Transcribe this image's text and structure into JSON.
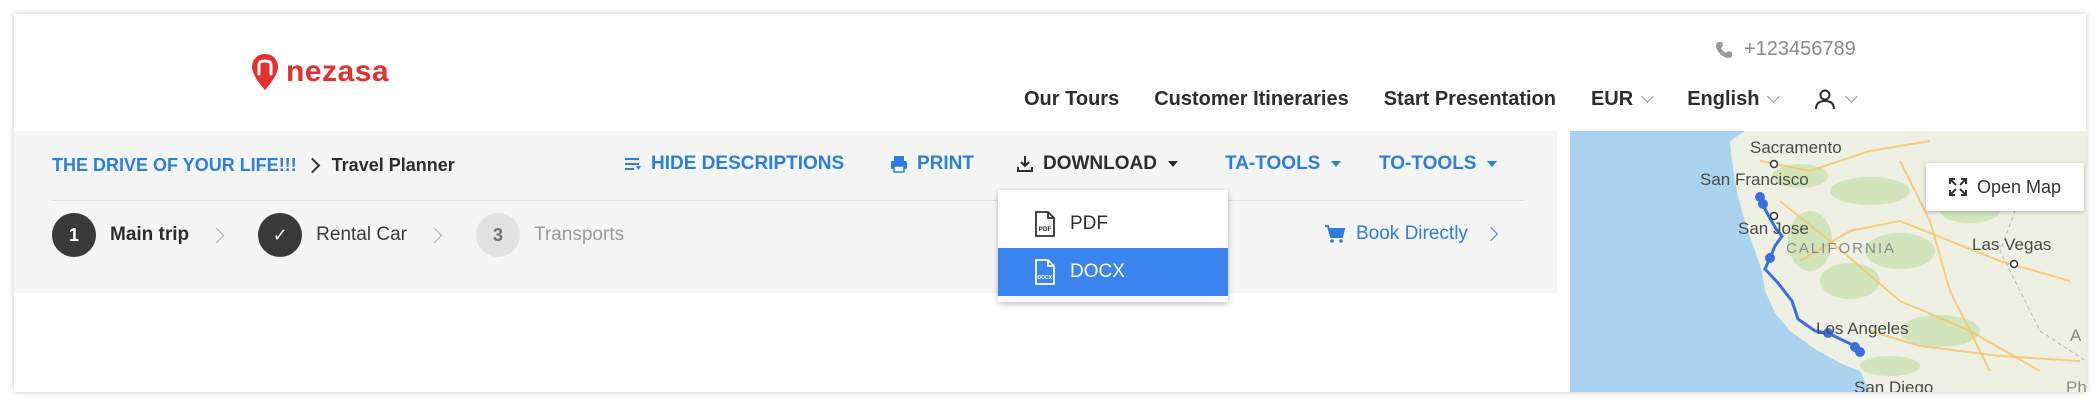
{
  "brand": {
    "name": "nezasa",
    "color": "#e63030"
  },
  "header": {
    "phone": "+123456789",
    "phone_icon": "phone-icon",
    "nav": {
      "our_tours": "Our Tours",
      "customer_itineraries": "Customer Itineraries",
      "start_presentation": "Start Presentation",
      "currency": "EUR",
      "language": "English",
      "user_icon": "user-icon"
    }
  },
  "breadcrumb": {
    "trip": "THE DRIVE OF YOUR LIFE!!!",
    "current": "Travel Planner"
  },
  "toolbar": {
    "hide_descriptions": "HIDE DESCRIPTIONS",
    "print": "PRINT",
    "download": "DOWNLOAD",
    "ta_tools": "TA-TOOLS",
    "to_tools": "TO-TOOLS"
  },
  "steps": [
    {
      "number": "1",
      "label": "Main trip",
      "state": "current"
    },
    {
      "number": "✓",
      "label": "Rental Car",
      "state": "done"
    },
    {
      "number": "3",
      "label": "Transports",
      "state": "pending"
    }
  ],
  "book_directly": "Book Directly",
  "download_menu": {
    "items": [
      {
        "label": "PDF",
        "icon_text": "PDF",
        "selected": false
      },
      {
        "label": "DOCX",
        "icon_text": "DOCX",
        "selected": true
      }
    ]
  },
  "map": {
    "open_map": "Open Map",
    "labels": {
      "sacramento": "Sacramento",
      "san_francisco": "San Francisco",
      "san_jose": "San Jose",
      "california": "CALIFORNIA",
      "las_vegas": "Las Vegas",
      "los_angeles": "Los Angeles",
      "san_diego": "San Diego",
      "edge_a": "A",
      "edge_ph": "Ph"
    }
  },
  "colors": {
    "accent": "#2b7fe2",
    "menu_selected": "#3b84f0",
    "toolbar_bg": "#f5f5f5",
    "ocean": "#aad3f0",
    "land": "#eef0e4",
    "route": "#3b6fe0"
  }
}
